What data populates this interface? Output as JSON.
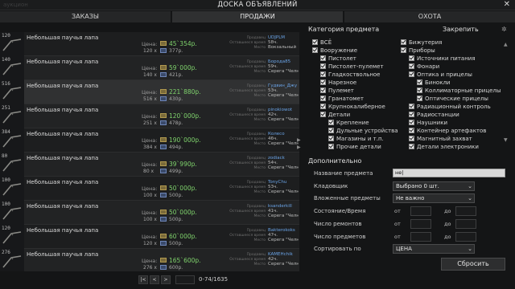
{
  "window": {
    "title": "ДОСКА ОБЪЯВЛЕНИЙ",
    "faint_left": "аукцион",
    "close_glyph": "✕"
  },
  "tabs": [
    {
      "label": "ЗАКАЗЫ",
      "active": false
    },
    {
      "label": "ПРОДАЖИ",
      "active": true
    },
    {
      "label": "ОХОТА",
      "active": false
    }
  ],
  "list": {
    "price_label": "Цена:",
    "meta_labels": [
      "Продавец",
      "Оставшееся время",
      "Место"
    ],
    "rows": [
      {
        "qty": "120",
        "name": "Небольшая паучья лапа",
        "price": "45`354р.",
        "count": "120 x",
        "unit": "377р.",
        "seller": "UDJPLM",
        "time": "58ч.",
        "place": "Вокзальный"
      },
      {
        "qty": "140",
        "name": "Небольшая паучья лапа",
        "price": "59`000р.",
        "count": "140 x",
        "unit": "421р.",
        "seller": "Борода85",
        "time": "59ч.",
        "place": "Серега \"Челн"
      },
      {
        "qty": "516",
        "name": "Небольшая паучья лапа",
        "price": "221`880р.",
        "count": "516 x",
        "unit": "430р.",
        "seller": "Гудвин_Джу",
        "time": "53ч.",
        "place": "Серега \"Челн"
      },
      {
        "qty": "251",
        "name": "Небольшая паучья лапа",
        "price": "120`000р.",
        "count": "251 x",
        "unit": "478р.",
        "seller": "pinokiowot",
        "time": "42ч.",
        "place": "Серега \"Челн"
      },
      {
        "qty": "384",
        "name": "Небольшая паучья лапа",
        "price": "190`000р.",
        "count": "384 x",
        "unit": "494р.",
        "seller": "Колесо",
        "time": "46ч.",
        "place": "Серега \"Челн"
      },
      {
        "qty": "80",
        "name": "Небольшая паучья лапа",
        "price": "39`990р.",
        "count": "80 x",
        "unit": "499р.",
        "seller": "zodiack",
        "time": "54ч.",
        "place": "Серега \"Челн"
      },
      {
        "qty": "100",
        "name": "Небольшая паучья лапа",
        "price": "50`000р.",
        "count": "100 x",
        "unit": "500р.",
        "seller": "TonyChu",
        "time": "53ч.",
        "place": "Серега \"Челн"
      },
      {
        "qty": "100",
        "name": "Небольшая паучья лапа",
        "price": "50`000р.",
        "count": "100 x",
        "unit": "500р.",
        "seller": "ksanderkill",
        "time": "41ч.",
        "place": "Серега \"Челн"
      },
      {
        "qty": "120",
        "name": "Небольшая паучья лапа",
        "price": "60`000р.",
        "count": "120 x",
        "unit": "500р.",
        "seller": "Bakterokoks",
        "time": "47ч.",
        "place": "Серега \"Челн"
      },
      {
        "qty": "276",
        "name": "Небольшая паучья лапа",
        "price": "165`600р.",
        "count": "276 x",
        "unit": "600р.",
        "seller": "KAMEHchik",
        "time": "42ч.",
        "place": "Серега \"Челн"
      }
    ]
  },
  "pager": {
    "first": "|<",
    "prev": "<",
    "next": ">",
    "range": "0-74/1635"
  },
  "category": {
    "title": "Категория предмета",
    "fix_label": "Закрепить",
    "fix_icon": "pin-icon",
    "items": [
      {
        "label": "ВСЁ",
        "col": 0,
        "indent": 0
      },
      {
        "label": "Вооружение",
        "col": 0,
        "indent": 0
      },
      {
        "label": "Пистолет",
        "col": 0,
        "indent": 1
      },
      {
        "label": "Пистолет-пулемет",
        "col": 0,
        "indent": 1
      },
      {
        "label": "Гладкоствольное",
        "col": 0,
        "indent": 1
      },
      {
        "label": "Нарезное",
        "col": 0,
        "indent": 1
      },
      {
        "label": "Пулемет",
        "col": 0,
        "indent": 1
      },
      {
        "label": "Гранатомет",
        "col": 0,
        "indent": 1
      },
      {
        "label": "Крупнокалиберное",
        "col": 0,
        "indent": 1
      },
      {
        "label": "Детали",
        "col": 0,
        "indent": 1
      },
      {
        "label": "Крепление",
        "col": 0,
        "indent": 2
      },
      {
        "label": "Дульные устройства",
        "col": 0,
        "indent": 2
      },
      {
        "label": "Магазины и т.п.",
        "col": 0,
        "indent": 2
      },
      {
        "label": "Прочие детали",
        "col": 0,
        "indent": 2
      },
      {
        "label": "Бижутерия",
        "col": 1,
        "indent": 0
      },
      {
        "label": "Приборы",
        "col": 1,
        "indent": 0
      },
      {
        "label": "Источники питания",
        "col": 1,
        "indent": 1
      },
      {
        "label": "Фонари",
        "col": 1,
        "indent": 1
      },
      {
        "label": "Оптика и прицелы",
        "col": 1,
        "indent": 1
      },
      {
        "label": "Бинокли",
        "col": 1,
        "indent": 2
      },
      {
        "label": "Коллиматорные прицелы",
        "col": 1,
        "indent": 2
      },
      {
        "label": "Оптические прицелы",
        "col": 1,
        "indent": 2
      },
      {
        "label": "Радиационный контроль",
        "col": 1,
        "indent": 1
      },
      {
        "label": "Радиостанции",
        "col": 1,
        "indent": 1
      },
      {
        "label": "Наушники",
        "col": 1,
        "indent": 1
      },
      {
        "label": "Контейнер артефактов",
        "col": 1,
        "indent": 1
      },
      {
        "label": "Магнитный захват",
        "col": 1,
        "indent": 1
      },
      {
        "label": "Детали электроники",
        "col": 1,
        "indent": 1
      }
    ]
  },
  "additional": {
    "title": "Дополнительно",
    "item_name_label": "Название предмета",
    "item_name_value": "не|",
    "storage_label": "Кладовщик",
    "storage_value": "Выбрано 0 шт.",
    "nested_label": "Вложенные предметы",
    "nested_value": "Не важно",
    "condition_label": "Состояние/Время",
    "repairs_label": "Число ремонтов",
    "count_label": "Число предметов",
    "from_label": "от",
    "to_label": "до",
    "sort_label": "Сортировать по",
    "sort_value": "ЦЕНА",
    "reset_label": "Сбросить"
  },
  "colors": {
    "price": "#7fd36c",
    "seller": "#6aa3e6",
    "background": "#141516"
  }
}
